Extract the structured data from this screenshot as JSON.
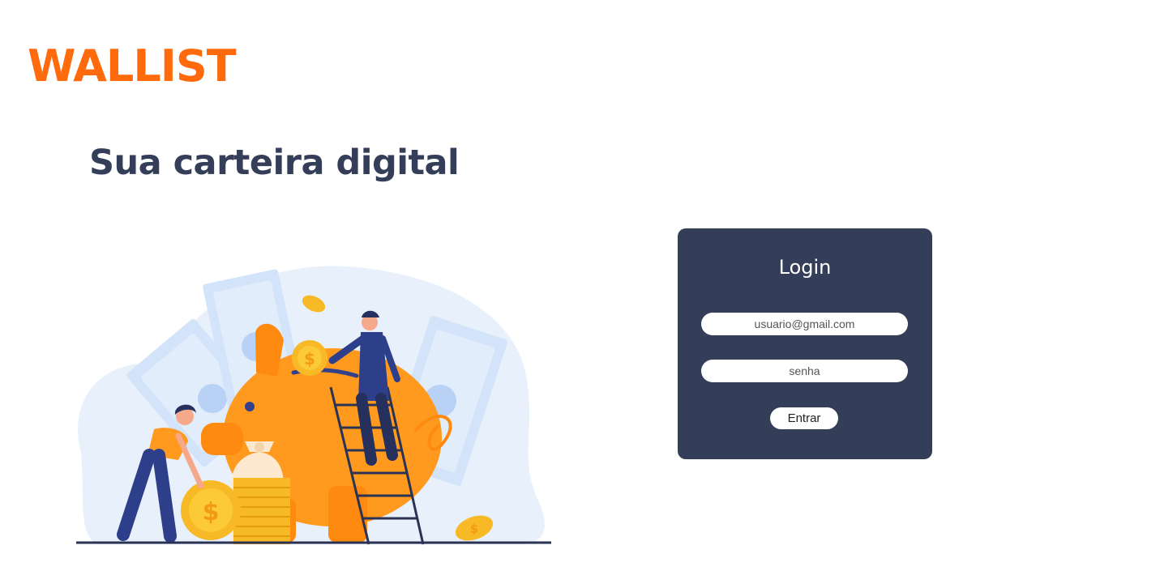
{
  "brand": {
    "logo_text": "WALLIST",
    "color": "#ff6a0d"
  },
  "hero": {
    "headline": "Sua carteira digital",
    "headline_color": "#343e59",
    "illustration": "piggy-bank-savings-illustration"
  },
  "login": {
    "title": "Login",
    "card_color": "#343e59",
    "email_placeholder": "usuario@gmail.com",
    "password_placeholder": "senha",
    "submit_label": "Entrar"
  }
}
